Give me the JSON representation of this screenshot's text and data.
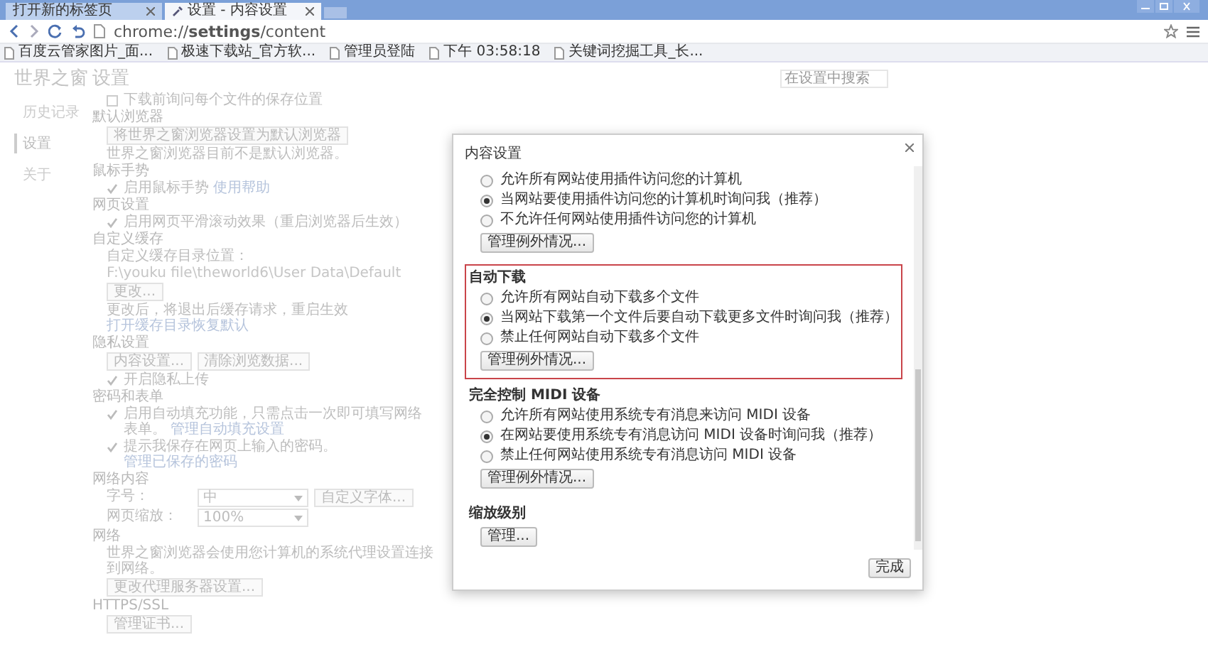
{
  "browser": {
    "tabs": [
      {
        "label": "打开新的标签页",
        "selected": false
      },
      {
        "label": "设置 - 内容设置",
        "selected": true
      }
    ],
    "address": "chrome://**settings**/content",
    "bookmarks": [
      "百度云管家图片_面...",
      "极速下载站_官方软...",
      "管理员登陆",
      "下午 03:58:18",
      "关键词挖掘工具_长..."
    ]
  },
  "sidebar": {
    "title": "世界之窗",
    "items": [
      {
        "label": "历史记录",
        "selected": false
      },
      {
        "label": "设置",
        "selected": true
      },
      {
        "label": "关于",
        "selected": false
      }
    ]
  },
  "settings": {
    "title": "设置",
    "search": {
      "placeholder": "在设置中搜索"
    },
    "sections": [
      {
        "rows": [
          {
            "kind": "check",
            "label": "下载前询问每个文件的保存位置",
            "checked": false
          }
        ]
      },
      {
        "heading": "默认浏览器",
        "rows": [
          {
            "kind": "buttons",
            "buttons": [
              "将世界之窗浏览器设置为默认浏览器"
            ]
          },
          {
            "kind": "text",
            "text": "世界之窗浏览器目前不是默认浏览器。"
          }
        ]
      },
      {
        "heading": "鼠标手势",
        "rows": [
          {
            "kind": "check",
            "label": "启用鼠标手势",
            "link": "使用帮助",
            "checked": true
          }
        ]
      },
      {
        "heading": "网页设置",
        "rows": [
          {
            "kind": "check",
            "label": "启用网页平滑滚动效果（重启浏览器后生效）",
            "checked": true
          }
        ]
      },
      {
        "heading": "自定义缓存",
        "rows": [
          {
            "kind": "field",
            "label": "自定义缓存目录位置：",
            "value": "F:\\youku file\\theworld6\\User Data\\Default",
            "button": "更改..."
          },
          {
            "kind": "text",
            "text": "更改后，将退出后缓存请求，重启生效",
            "links": [
              "打开缓存目录",
              "恢复默认"
            ]
          }
        ]
      },
      {
        "heading": "隐私设置",
        "rows": [
          {
            "kind": "buttons",
            "buttons": [
              "内容设置...",
              "清除浏览数据..."
            ]
          },
          {
            "kind": "check",
            "label": "开启隐私上传",
            "checked": true
          }
        ]
      },
      {
        "heading": "密码和表单",
        "rows": [
          {
            "kind": "check",
            "label": "启用自动填充功能，只需点击一次即可填写网络表单。",
            "link": "管理自动填充设置",
            "checked": true
          },
          {
            "kind": "check",
            "label": "提示我保存在网页上输入的密码。",
            "link": "管理已保存的密码",
            "checked": true
          }
        ]
      },
      {
        "heading": "网络内容",
        "rows": [
          {
            "kind": "select",
            "label": "字号：",
            "value": "中",
            "button": "自定义字体..."
          },
          {
            "kind": "select",
            "label": "网页缩放：",
            "value": "100%"
          }
        ]
      },
      {
        "heading": "网络",
        "rows": [
          {
            "kind": "text",
            "text": "世界之窗浏览器会使用您计算机的系统代理设置连接到网络。"
          },
          {
            "kind": "buttons",
            "buttons": [
              "更改代理服务器设置..."
            ]
          }
        ]
      },
      {
        "heading": "HTTPS/SSL",
        "rows": [
          {
            "kind": "buttons",
            "buttons": [
              "管理证书..."
            ]
          }
        ]
      }
    ]
  },
  "dialog": {
    "title": "内容设置",
    "done": "完成",
    "sections": [
      {
        "highlighted": false,
        "options": [
          {
            "label": "允许所有网站使用插件访问您的计算机",
            "selected": false
          },
          {
            "label": "当网站要使用插件访问您的计算机时询问我（推荐）",
            "selected": true
          },
          {
            "label": "不允许任何网站使用插件访问您的计算机",
            "selected": false
          }
        ],
        "button": "管理例外情况..."
      },
      {
        "heading": "自动下载",
        "highlighted": true,
        "options": [
          {
            "label": "允许所有网站自动下载多个文件",
            "selected": false
          },
          {
            "label": "当网站下载第一个文件后要自动下载更多文件时询问我（推荐）",
            "selected": true
          },
          {
            "label": "禁止任何网站自动下载多个文件",
            "selected": false
          }
        ],
        "button": "管理例外情况..."
      },
      {
        "heading": "完全控制 MIDI 设备",
        "highlighted": false,
        "options": [
          {
            "label": "允许所有网站使用系统专有消息来访问 MIDI 设备",
            "selected": false
          },
          {
            "label": "在网站要使用系统专有消息访问 MIDI 设备时询问我（推荐）",
            "selected": true
          },
          {
            "label": "禁止任何网站使用系统专有消息访问 MIDI 设备",
            "selected": false
          }
        ],
        "button": "管理例外情况..."
      },
      {
        "heading": "缩放级别",
        "highlighted": false,
        "button": "管理..."
      }
    ]
  }
}
